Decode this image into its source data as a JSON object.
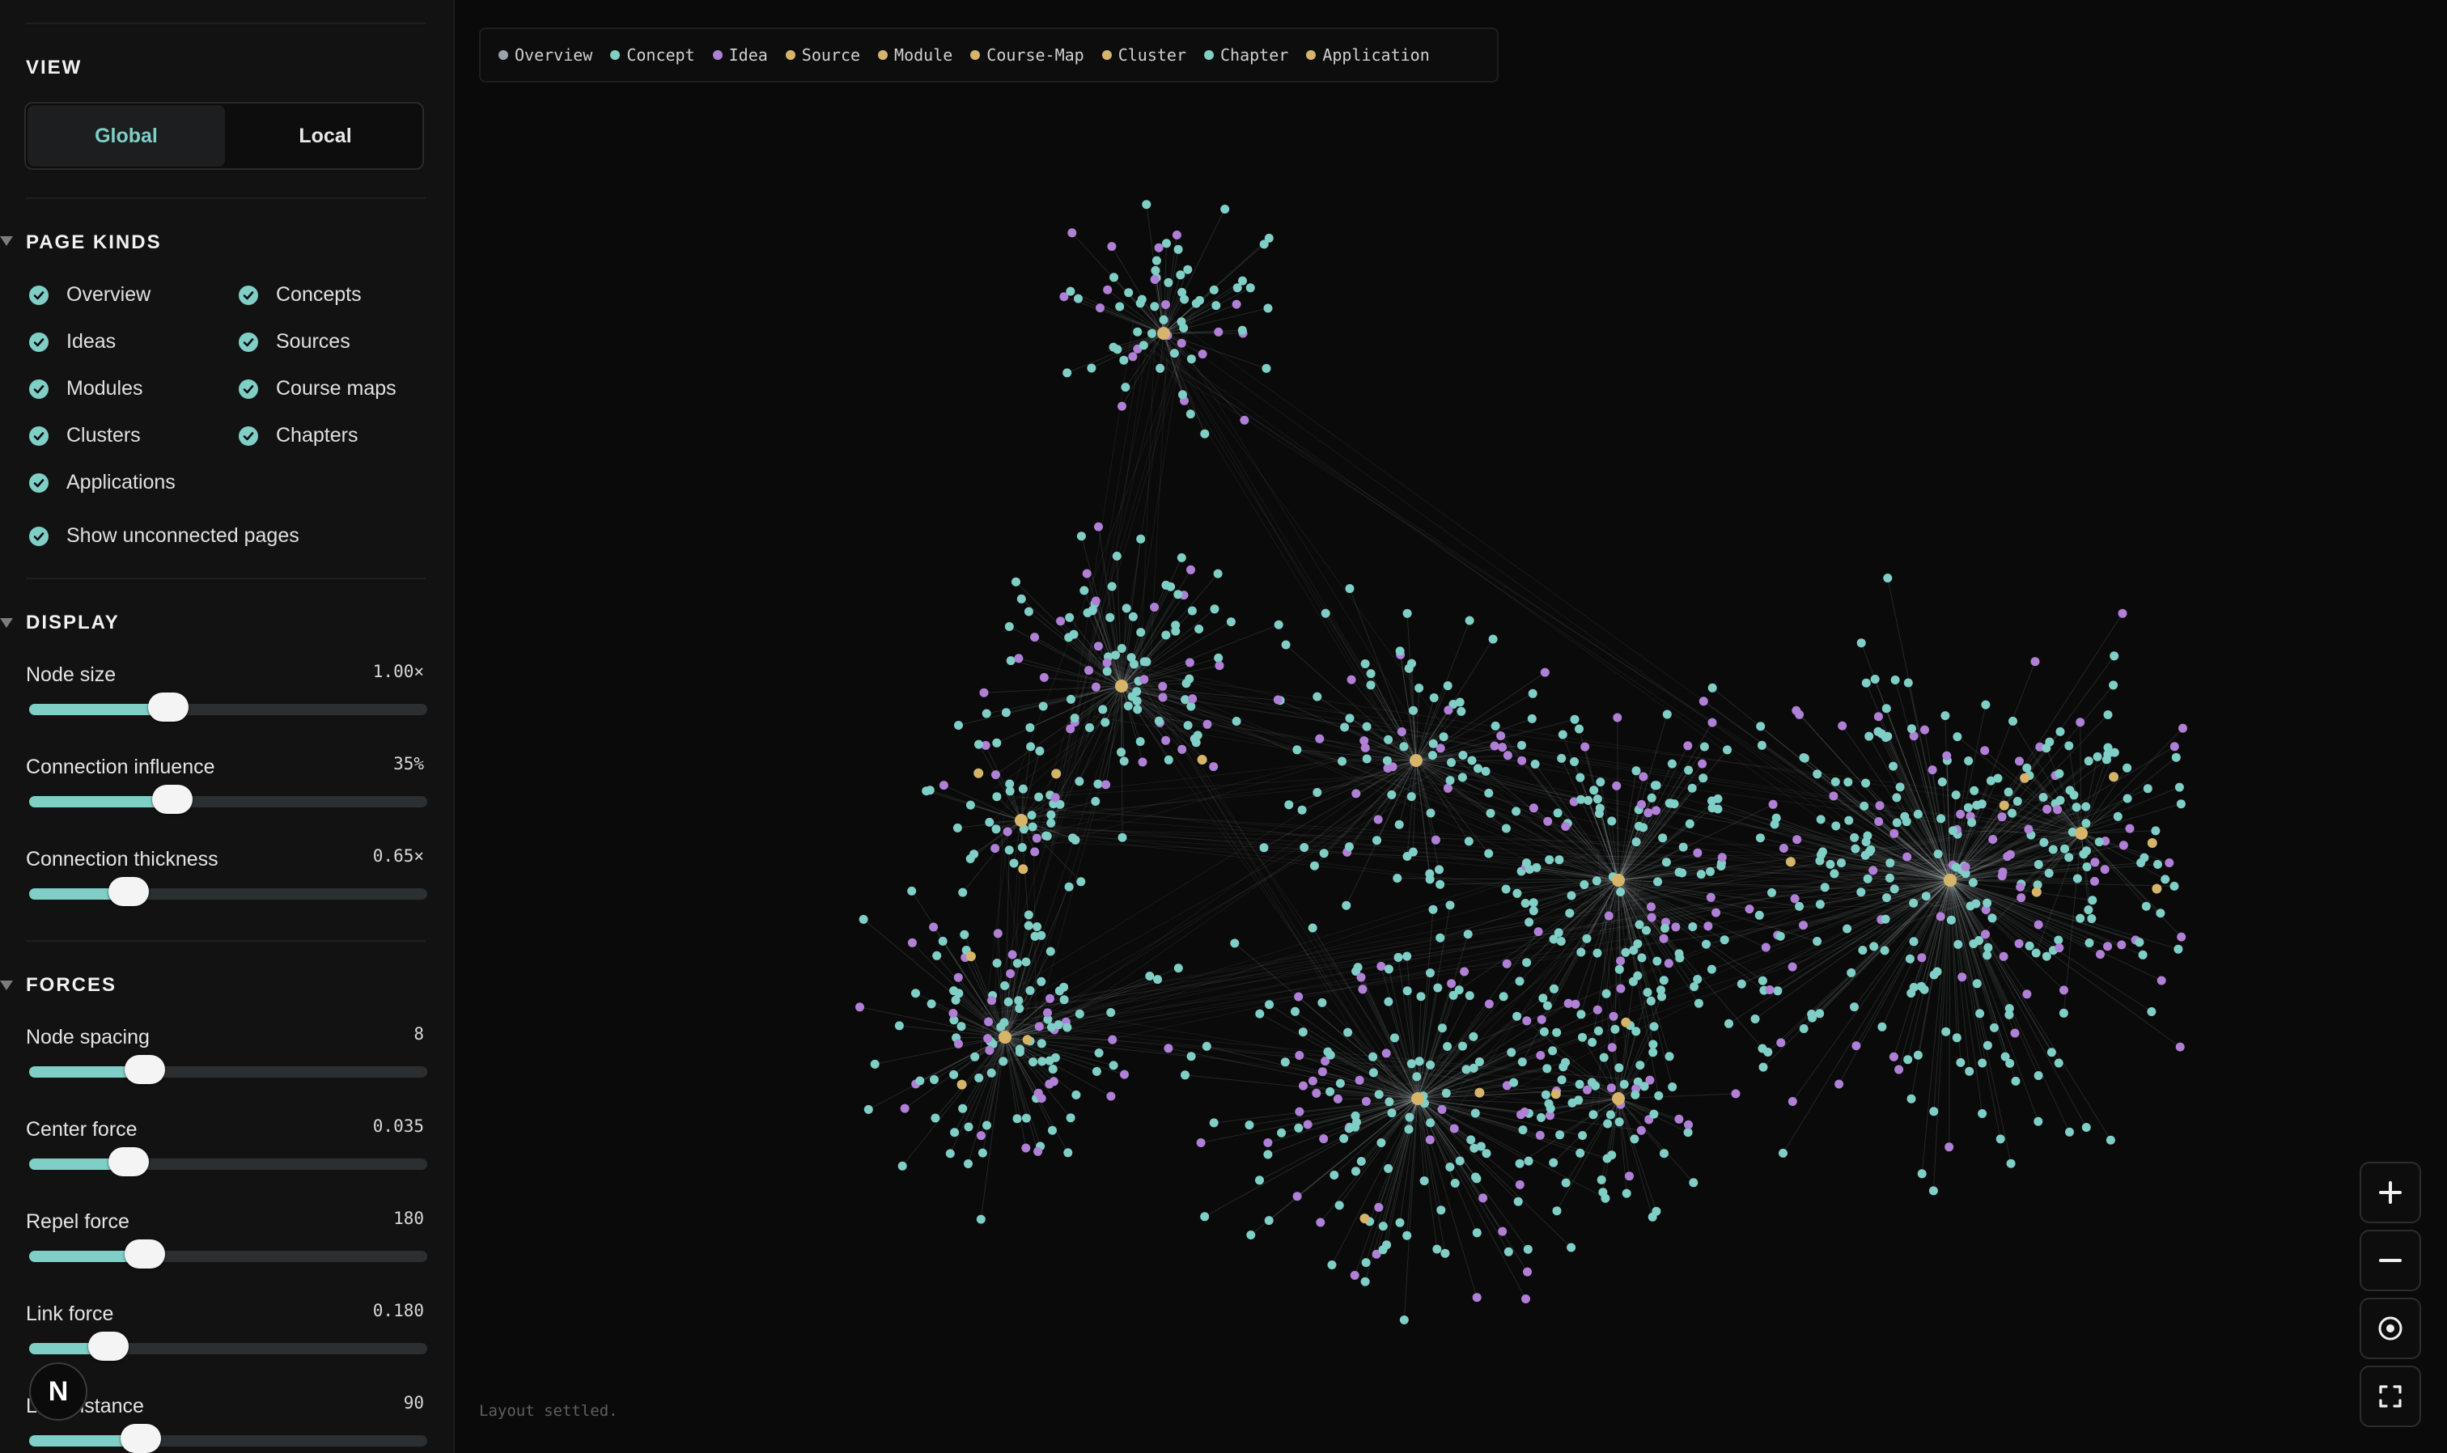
{
  "sidebar": {
    "view": {
      "title": "VIEW",
      "options": [
        "Global",
        "Local"
      ],
      "selected": "Global"
    },
    "page_kinds": {
      "title": "PAGE KINDS",
      "items": [
        {
          "label": "Overview",
          "checked": true
        },
        {
          "label": "Concepts",
          "checked": true
        },
        {
          "label": "Ideas",
          "checked": true
        },
        {
          "label": "Sources",
          "checked": true
        },
        {
          "label": "Modules",
          "checked": true
        },
        {
          "label": "Course maps",
          "checked": true
        },
        {
          "label": "Clusters",
          "checked": true
        },
        {
          "label": "Chapters",
          "checked": true
        },
        {
          "label": "Applications",
          "checked": true
        }
      ],
      "show_unconnected": {
        "label": "Show unconnected pages",
        "checked": true
      }
    },
    "display": {
      "title": "DISPLAY",
      "sliders": [
        {
          "label": "Node size",
          "value": "1.00×",
          "level": 0.35
        },
        {
          "label": "Connection influence",
          "value": "35%",
          "level": 0.36
        },
        {
          "label": "Connection thickness",
          "value": "0.65×",
          "level": 0.25
        }
      ]
    },
    "forces": {
      "title": "FORCES",
      "sliders": [
        {
          "label": "Node spacing",
          "value": "8",
          "level": 0.29
        },
        {
          "label": "Center force",
          "value": "0.035",
          "level": 0.25
        },
        {
          "label": "Repel force",
          "value": "180",
          "level": 0.29
        },
        {
          "label": "Link force",
          "value": "0.180",
          "level": 0.2
        },
        {
          "label": "Link distance",
          "value": "90",
          "level": 0.28
        }
      ]
    },
    "avatar_letter": "N"
  },
  "legend": [
    {
      "label": "Overview",
      "color": "#9aa3ad"
    },
    {
      "label": "Concept",
      "color": "#7fcfc6"
    },
    {
      "label": "Idea",
      "color": "#b07fd6"
    },
    {
      "label": "Source",
      "color": "#d6b56a"
    },
    {
      "label": "Module",
      "color": "#d6b56a"
    },
    {
      "label": "Course-Map",
      "color": "#d6b56a"
    },
    {
      "label": "Cluster",
      "color": "#d6b56a"
    },
    {
      "label": "Chapter",
      "color": "#7fcfc6"
    },
    {
      "label": "Application",
      "color": "#d6b56a"
    }
  ],
  "status": "Layout settled.",
  "controls": {
    "zoom_in": "plus-icon",
    "zoom_out": "minus-icon",
    "recenter": "target-icon",
    "fullscreen": "fullscreen-icon"
  },
  "colors": {
    "accent": "#7fcfc6",
    "idea": "#b07fd6",
    "hub": "#d6b56a",
    "background": "#0a0a0a"
  }
}
